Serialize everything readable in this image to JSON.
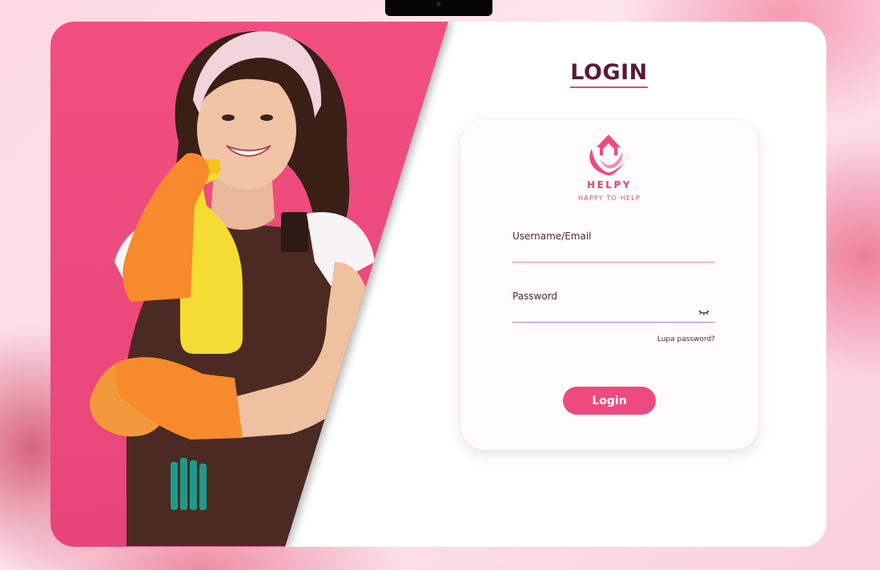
{
  "header": {
    "title": "LOGIN"
  },
  "brand": {
    "name": "HELPY",
    "tagline": "HAPPY TO HELP"
  },
  "form": {
    "username_label": "Username/Email",
    "username_value": "",
    "password_label": "Password",
    "password_value": "",
    "forgot_link": "Lupa password?",
    "submit_label": "Login"
  },
  "colors": {
    "accent": "#ef4a7e",
    "title": "#5a1a34",
    "hero_background": "#f0517f",
    "panel": "#fffafb"
  },
  "icons": [
    "helpy-logo-icon",
    "eye-closed-icon"
  ]
}
